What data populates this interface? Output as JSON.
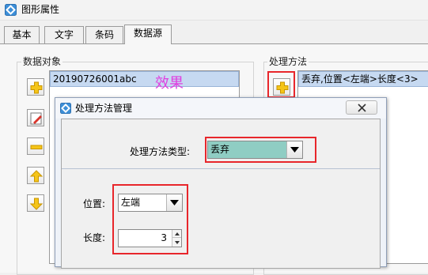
{
  "window": {
    "title": "图形属性",
    "tabs": [
      {
        "label": "基本",
        "active": false
      },
      {
        "label": "文字",
        "active": false
      },
      {
        "label": "条码",
        "active": false
      },
      {
        "label": "数据源",
        "active": true
      }
    ]
  },
  "data_objects": {
    "group_label": "数据对象",
    "items": [
      "20190726001abc"
    ],
    "tool_buttons": [
      "add-icon",
      "edit-icon",
      "remove-icon",
      "move-up-icon",
      "move-down-icon"
    ]
  },
  "processing": {
    "group_label": "处理方法",
    "items": [
      "丢弃,位置<左端>长度<3>"
    ]
  },
  "annotation": {
    "text": "效果",
    "color": "#e040e0"
  },
  "dialog": {
    "title": "处理方法管理",
    "type_label": "处理方法类型:",
    "type_value": "丢弃",
    "position_label": "位置:",
    "position_value": "左端",
    "length_label": "长度:",
    "length_value": "3"
  },
  "colors": {
    "highlight_box": "#e8262b",
    "selection": "#c6d9f1",
    "type_combo_bg": "#8fcdc3"
  }
}
